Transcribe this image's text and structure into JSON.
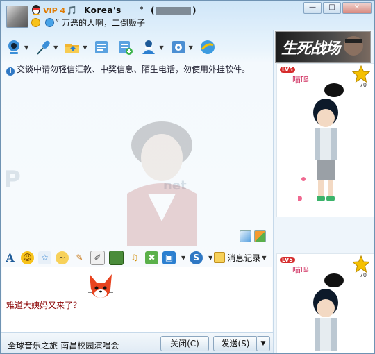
{
  "window": {
    "vip": "VIP 4",
    "nick_prefix": "Korea's",
    "nick_mid": "°",
    "nick_paren_open": "(",
    "nick_paren_close": ")",
    "signature": "” 万恶的人啊，二倒贩子"
  },
  "toolbar": {
    "items": [
      "video-call",
      "voice-call",
      "send-file",
      "send-sms",
      "create-group",
      "remote-assist",
      "app-settings",
      "more-apps"
    ]
  },
  "warning": "交谈中请勿轻信汇款、中奖信息、陌生电话，勿使用外挂软件。",
  "chat": {
    "bg_text": "P",
    "bg_text2": "net"
  },
  "format_bar": {
    "history_label": "消息记录"
  },
  "input": {
    "text": "难道大姨妈又来了？"
  },
  "bottom": {
    "status": "全球音乐之旅-南昌校园演唱会",
    "close_label": "关闭(C)",
    "send_label": "发送(S)"
  },
  "right": {
    "banner": "生死战场",
    "show1": {
      "level": "LV5",
      "caption": "喵呜",
      "star_score": "70"
    },
    "show2": {
      "level": "LV5",
      "caption": "喵呜",
      "star_score": "70"
    }
  },
  "colors": {
    "accent": "#2f78c4",
    "input_text": "#8a0000"
  }
}
